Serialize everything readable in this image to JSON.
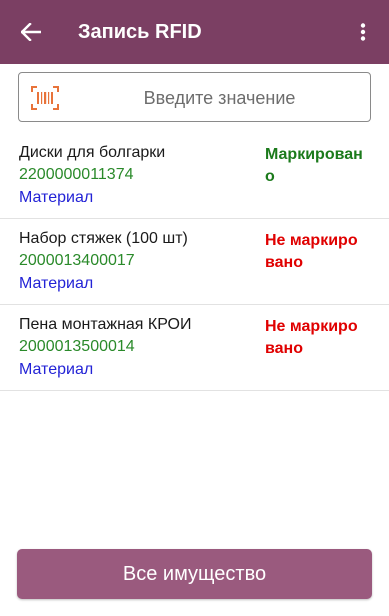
{
  "appbar": {
    "title": "Запись RFID",
    "back_icon": "arrow-left-icon",
    "menu_icon": "more-vert-icon",
    "color": "#7b3f63"
  },
  "scan_field": {
    "placeholder": "Введите значение",
    "icon": "barcode-icon",
    "icon_color": "#e8733a"
  },
  "items": [
    {
      "name": "Диски для болгарки",
      "code": "2200000011374",
      "type": "Материал",
      "status": "Маркирован о"
    },
    {
      "name": "Набор стяжек (100 шт)",
      "code": "2000013400017",
      "type": "Материал",
      "status": "Не маркиро вано"
    },
    {
      "name": "Пена монтажная КРОИ",
      "code": "2000013500014",
      "type": "Материал",
      "status": "Не маркиро вано"
    }
  ],
  "bottom_button": {
    "label": "Все имущество",
    "color": "#9a5a7e"
  }
}
